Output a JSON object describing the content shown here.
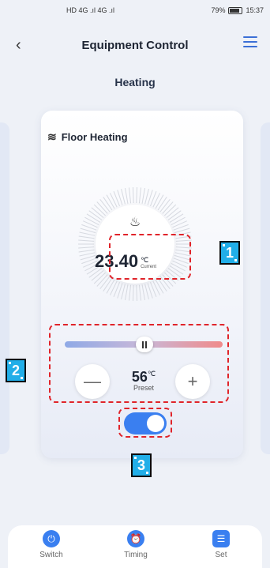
{
  "status_bar": {
    "left_text": "HD 4G .ıl 4G .ıl",
    "battery": "79%",
    "time": "15:37"
  },
  "header": {
    "title": "Equipment Control"
  },
  "section_title": "Heating",
  "card": {
    "name": "Floor Heating",
    "current_temp": "23.40",
    "temp_unit": "℃",
    "current_label": "Current",
    "preset_temp": "56",
    "preset_unit": "℃",
    "preset_label": "Preset",
    "minus_symbol": "—",
    "plus_symbol": "+",
    "toggle_on": true,
    "slider_value": 0.5
  },
  "annotations": {
    "label_1": "1",
    "label_2": "2",
    "label_3": "3"
  },
  "bottom_nav": {
    "items": [
      {
        "label": "Switch",
        "icon": "power-icon"
      },
      {
        "label": "Timing",
        "icon": "alarm-clock-icon"
      },
      {
        "label": "Set",
        "icon": "settings-sliders-icon"
      }
    ]
  }
}
